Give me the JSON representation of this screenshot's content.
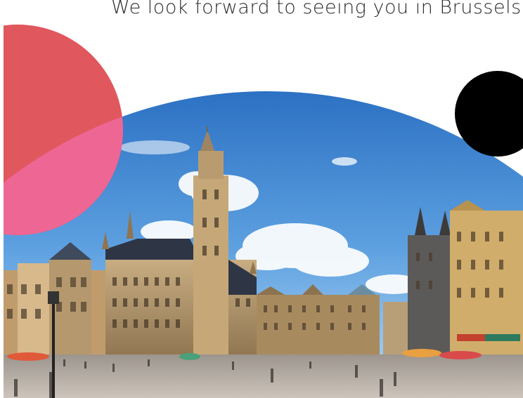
{
  "headline": "We look forward to seeing you in Brussels.",
  "colors": {
    "red_accent": "#e0575e",
    "pink_overlay": "#f06aa0",
    "black_dot": "#000000",
    "sky_top": "#2f78c9",
    "sky_bottom": "#8ec3ee",
    "building_stone": "#b89b72",
    "square_pavement": "#bfb6ad"
  },
  "image": {
    "subject": "Grand Place, Brussels"
  }
}
